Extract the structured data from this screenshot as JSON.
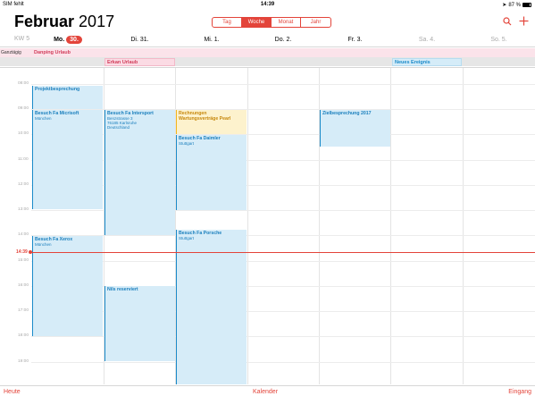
{
  "status_bar": {
    "carrier": "SIM fehlt",
    "time": "14:39",
    "battery": "87 %"
  },
  "header": {
    "month": "Februar",
    "year": "2017",
    "views": [
      "Tag",
      "Woche",
      "Monat",
      "Jahr"
    ],
    "active_view": "Woche",
    "search_icon": "search-icon",
    "add_icon": "plus-icon"
  },
  "week": {
    "kw": "KW 5",
    "days": [
      {
        "label": "Mo.",
        "num": "30."
      },
      {
        "label": "Di. 31."
      },
      {
        "label": "Mi. 1."
      },
      {
        "label": "Do. 2."
      },
      {
        "label": "Fr. 3."
      },
      {
        "label": "Sa. 4."
      },
      {
        "label": "So. 5."
      }
    ]
  },
  "allday": {
    "label": "Ganztägig",
    "events": [
      {
        "title": "Danping Urlaub"
      },
      {
        "title": "Erkan Urlaub"
      },
      {
        "title": "Neues Ereignis"
      }
    ]
  },
  "hours": [
    "08:00",
    "09:00",
    "10:00",
    "11:00",
    "12:00",
    "13:00",
    "14:00",
    "15:00",
    "16:00",
    "17:00",
    "18:00",
    "19:00"
  ],
  "now": {
    "label": "14:39"
  },
  "events": [
    {
      "title": "Projektbesprechung",
      "sub": ""
    },
    {
      "title": "Besuch Fa Micrisoft",
      "sub": "München"
    },
    {
      "title": "Besuch Fa Xerox",
      "sub": "München"
    },
    {
      "title": "Besuch Fa Intersport",
      "sub": "Benzstrasse 3\n76185 Karlsruhe\nDeutschland"
    },
    {
      "title": "Nils reserviert",
      "sub": ""
    },
    {
      "title": "Rechnungen Wartungsverträge Pearl",
      "sub": ""
    },
    {
      "title": "Besuch Fa Daimler",
      "sub": "Stuttgart"
    },
    {
      "title": "Besuch Fa Porsche",
      "sub": "Stuttgart"
    },
    {
      "title": "Zielbesprechung 2017",
      "sub": ""
    }
  ],
  "toolbar": {
    "today": "Heute",
    "calendars": "Kalender",
    "inbox": "Eingang"
  },
  "colors": {
    "accent": "#e3443a",
    "event_blue": "#d6ecf8",
    "event_yellow": "#fdf2cd",
    "allday_pink": "#fbe3ea"
  }
}
